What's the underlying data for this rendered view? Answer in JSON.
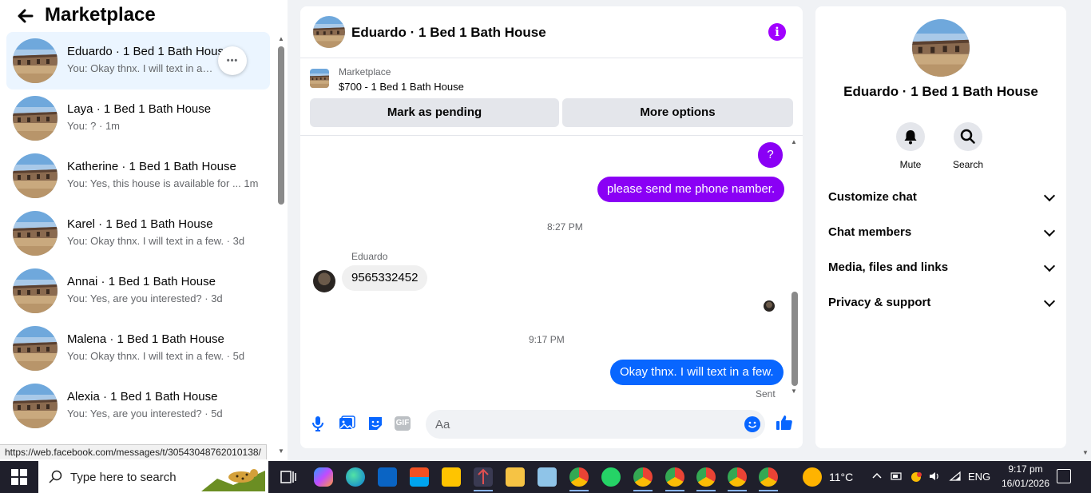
{
  "sidebar": {
    "title": "Marketplace",
    "conversations": [
      {
        "name": "Eduardo · 1 Bed 1 Bath House",
        "snippet": "You: Okay thnx. I will text in a few."
      },
      {
        "name": "Laya · 1 Bed 1 Bath House",
        "snippet": "You: ? · 1m"
      },
      {
        "name": "Katherine · 1 Bed 1 Bath House",
        "snippet": "You: Yes, this house is available for ...  1m"
      },
      {
        "name": "Karel · 1 Bed 1 Bath House",
        "snippet": "You: Okay thnx. I will text in a few. · 3d"
      },
      {
        "name": "Annai · 1 Bed 1 Bath House",
        "snippet": "You: Yes, are you interested? · 3d"
      },
      {
        "name": "Malena · 1 Bed 1 Bath House",
        "snippet": "You: Okay thnx. I will text in a few. · 5d"
      },
      {
        "name": "Alexia · 1 Bed 1 Bath House",
        "snippet": "You: Yes, are you interested? · 5d"
      }
    ],
    "more_label": "•••",
    "status_url": "https://web.facebook.com/messages/t/30543048762010138/"
  },
  "chat": {
    "title": "Eduardo · 1 Bed 1 Bath House",
    "info_icon": "i",
    "marketplace_label": "Marketplace",
    "listing": "$700 - 1 Bed 1 Bath House",
    "mark_pending": "Mark as pending",
    "more_options": "More options",
    "messages": {
      "question": "?",
      "phone_request": "please send me phone namber.",
      "time1": "8:27 PM",
      "sender": "Eduardo",
      "number": "9565332452",
      "time2": "9:17 PM",
      "reply": "Okay thnx. I will text in a few.",
      "sent": "Sent"
    },
    "input_placeholder": "Aa",
    "gif_label": "GIF"
  },
  "details": {
    "name": "Eduardo · 1 Bed 1 Bath House",
    "mute_label": "Mute",
    "search_label": "Search",
    "sections": [
      "Customize chat",
      "Chat members",
      "Media, files and links",
      "Privacy & support"
    ]
  },
  "taskbar": {
    "search_placeholder": "Type here to search",
    "weather": "11°C",
    "language": "ENG",
    "time": "9:17 pm",
    "date": "16/01/2026"
  },
  "colors": {
    "accent_purple": "#8a00f5",
    "messenger_blue": "#0866ff",
    "active_row": "#ebf5ff"
  }
}
